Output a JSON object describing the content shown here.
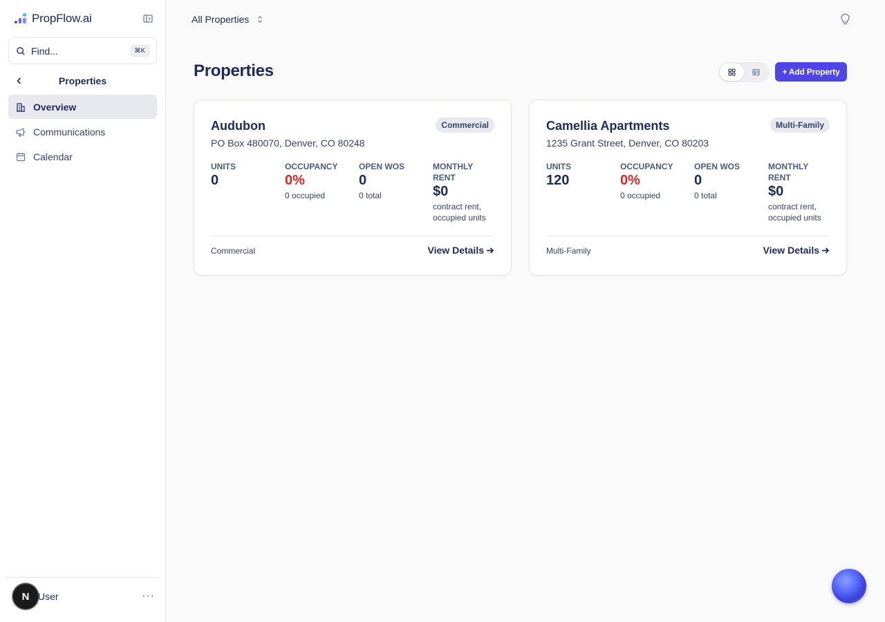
{
  "brand": {
    "name": "PropFlow.ai"
  },
  "search": {
    "placeholder": "Find...",
    "shortcut": "⌘K"
  },
  "nav": {
    "title": "Properties",
    "items": [
      {
        "label": "Overview",
        "icon": "building-icon",
        "active": true
      },
      {
        "label": "Communications",
        "icon": "megaphone-icon",
        "active": false
      },
      {
        "label": "Calendar",
        "icon": "calendar-icon",
        "active": false
      }
    ]
  },
  "user": {
    "initial": "N",
    "name": "User"
  },
  "topbar": {
    "property_select": "All Properties"
  },
  "page": {
    "title": "Properties",
    "add_button": "+ Add Property"
  },
  "properties": [
    {
      "name": "Audubon",
      "address": "PO Box 480070, Denver, CO 80248",
      "badge": "Commercial",
      "units": {
        "label": "UNITS",
        "value": "0"
      },
      "occupancy": {
        "label": "OCCUPANCY",
        "value": "0%",
        "sub": "0 occupied"
      },
      "open_wos": {
        "label": "OPEN WOS",
        "value": "0",
        "sub": "0 total"
      },
      "monthly_rent": {
        "label": "MONTHLY RENT",
        "value": "$0",
        "sub": "contract rent, occupied units"
      },
      "type": "Commercial",
      "details": "View Details"
    },
    {
      "name": "Camellia Apartments",
      "address": "1235 Grant Street, Denver, CO 80203",
      "badge": "Multi-Family",
      "units": {
        "label": "UNITS",
        "value": "120"
      },
      "occupancy": {
        "label": "OCCUPANCY",
        "value": "0%",
        "sub": "0 occupied"
      },
      "open_wos": {
        "label": "OPEN WOS",
        "value": "0",
        "sub": "0 total"
      },
      "monthly_rent": {
        "label": "MONTHLY RENT",
        "value": "$0",
        "sub": "contract rent, occupied units"
      },
      "type": "Multi-Family",
      "details": "View Details"
    }
  ],
  "colors": {
    "accent": "#4f46e5",
    "occupancy_alert": "#dc2626",
    "text_primary": "#1e2a5a"
  }
}
